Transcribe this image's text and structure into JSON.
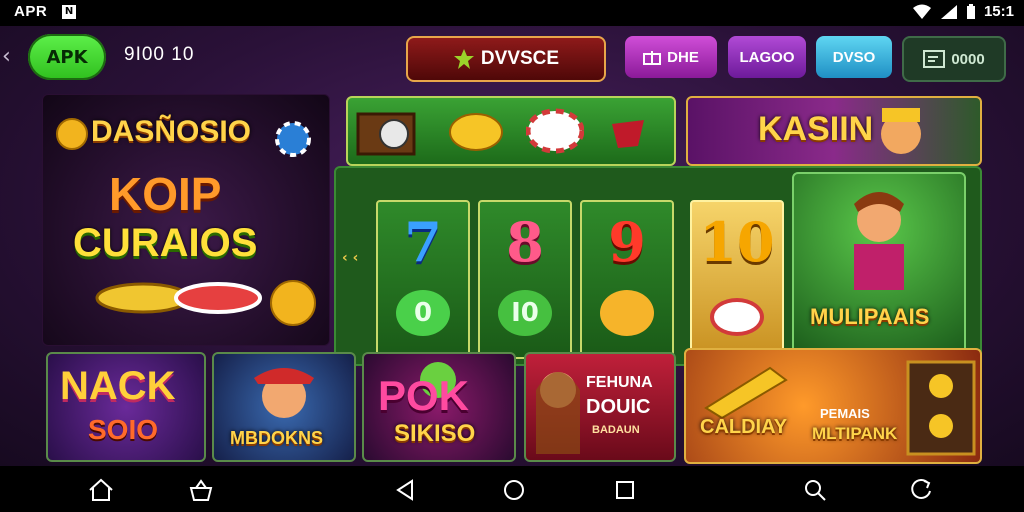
{
  "status": {
    "carrier": "APR",
    "badge": "N",
    "time": "15:1"
  },
  "header": {
    "apk_label": "APK",
    "code": "9I00 10",
    "main_button": "DVVSCE",
    "buttons": [
      "DHE",
      "LAGOO",
      "DVSO",
      "0000"
    ]
  },
  "tiles": {
    "dasnosio": {
      "title": "DASÑOSIO",
      "line1": "KOIP",
      "line2": "CURAIOS"
    },
    "kasiin": {
      "title": "KASIIN"
    },
    "reels": [
      "7",
      "8",
      "9",
      "10"
    ],
    "reel_coins": [
      "0",
      "I0",
      "",
      ""
    ],
    "multipaais": {
      "title": "MULIPAAIS"
    },
    "nack": {
      "line1": "NACK",
      "line2": "SOIO"
    },
    "mboking": {
      "title": "MBDOKNS"
    },
    "pok": {
      "line1": "POK",
      "line2": "SIKISO"
    },
    "fehuna": {
      "line1": "FEHUNA",
      "line2": "DOUIC",
      "line3": "BADAUN"
    },
    "calday": {
      "title": "CALDIAY",
      "sub1": "PEMAIS",
      "sub2": "MLTIPANK"
    },
    "side_mark": "‹ ‹"
  },
  "colors": {
    "bg_purple": "#2a1138",
    "accent_green": "#3fd62a",
    "gold": "#ffd44a"
  }
}
